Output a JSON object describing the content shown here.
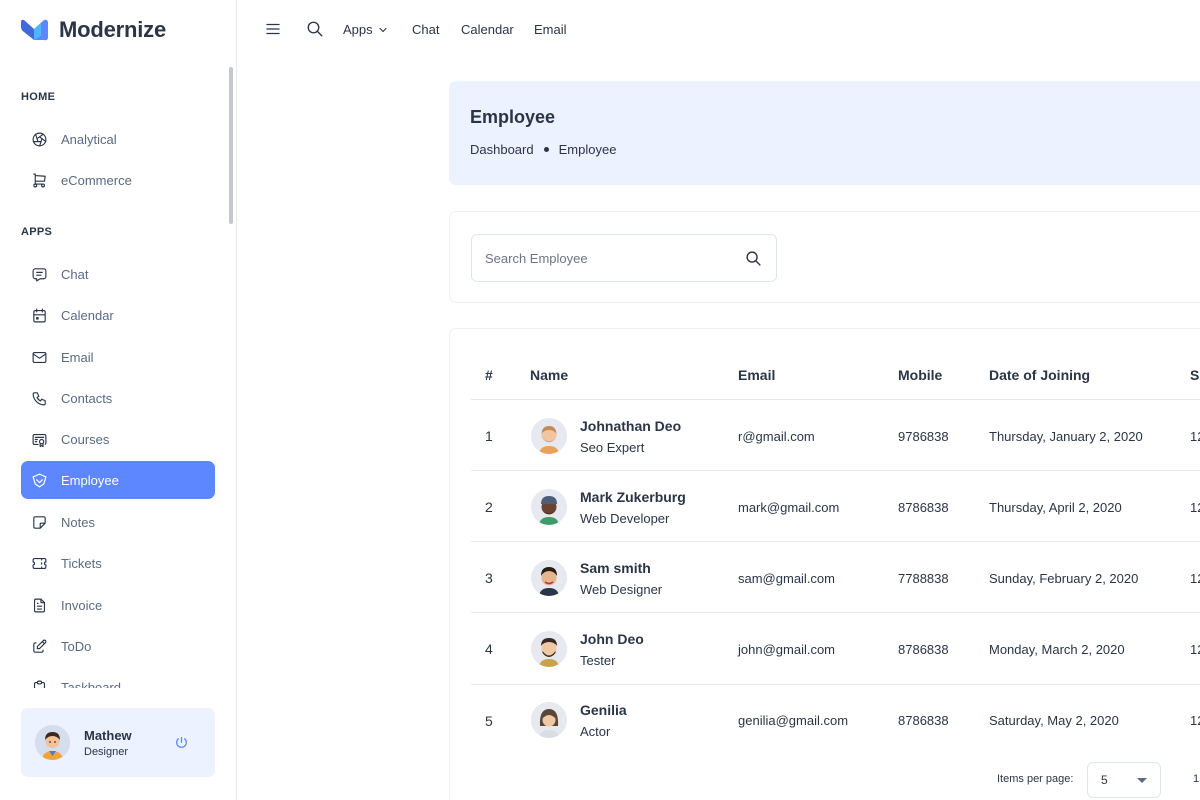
{
  "app": {
    "name": "Modernize"
  },
  "sidebar": {
    "sections": [
      {
        "title": "HOME",
        "items": [
          {
            "label": "Analytical",
            "icon": "aperture-icon"
          },
          {
            "label": "eCommerce",
            "icon": "shopping-cart-icon"
          }
        ]
      },
      {
        "title": "APPS",
        "items": [
          {
            "label": "Chat",
            "icon": "message-icon"
          },
          {
            "label": "Calendar",
            "icon": "calendar-icon"
          },
          {
            "label": "Email",
            "icon": "mail-icon"
          },
          {
            "label": "Contacts",
            "icon": "phone-icon"
          },
          {
            "label": "Courses",
            "icon": "certificate-icon"
          },
          {
            "label": "Employee",
            "icon": "brand-icon",
            "active": true
          },
          {
            "label": "Notes",
            "icon": "note-icon"
          },
          {
            "label": "Tickets",
            "icon": "ticket-icon"
          },
          {
            "label": "Invoice",
            "icon": "file-text-icon"
          },
          {
            "label": "ToDo",
            "icon": "edit-icon"
          },
          {
            "label": "Taskboard",
            "icon": "clipboard-icon"
          }
        ]
      }
    ],
    "user": {
      "name": "Mathew",
      "role": "Designer"
    }
  },
  "topbar": {
    "links": [
      {
        "label": "Apps",
        "dropdown": true
      },
      {
        "label": "Chat"
      },
      {
        "label": "Calendar"
      },
      {
        "label": "Email"
      }
    ]
  },
  "header": {
    "title": "Employee",
    "breadcrumb": [
      "Dashboard",
      "Employee"
    ]
  },
  "search": {
    "placeholder": "Search Employee",
    "value": ""
  },
  "table": {
    "columns": [
      "#",
      "Name",
      "Email",
      "Mobile",
      "Date of Joining",
      "S"
    ],
    "rows": [
      {
        "id": "1",
        "name": "Johnathan Deo",
        "role": "Seo Expert",
        "email": "r@gmail.com",
        "mobile": "9786838",
        "joined": "Thursday, January 2, 2020",
        "trail": "12"
      },
      {
        "id": "2",
        "name": "Mark Zukerburg",
        "role": "Web Developer",
        "email": "mark@gmail.com",
        "mobile": "8786838",
        "joined": "Thursday, April 2, 2020",
        "trail": "12"
      },
      {
        "id": "3",
        "name": "Sam smith",
        "role": "Web Designer",
        "email": "sam@gmail.com",
        "mobile": "7788838",
        "joined": "Sunday, February 2, 2020",
        "trail": "12"
      },
      {
        "id": "4",
        "name": "John Deo",
        "role": "Tester",
        "email": "john@gmail.com",
        "mobile": "8786838",
        "joined": "Monday, March 2, 2020",
        "trail": "12"
      },
      {
        "id": "5",
        "name": "Genilia",
        "role": "Actor",
        "email": "genilia@gmail.com",
        "mobile": "8786838",
        "joined": "Saturday, May 2, 2020",
        "trail": "12"
      }
    ]
  },
  "pagination": {
    "items_label": "Items per page:",
    "page_size": "5",
    "range": "1"
  },
  "colors": {
    "primary": "#5d87ff",
    "light_primary": "#ecf2ff",
    "text": "#2a3547"
  }
}
